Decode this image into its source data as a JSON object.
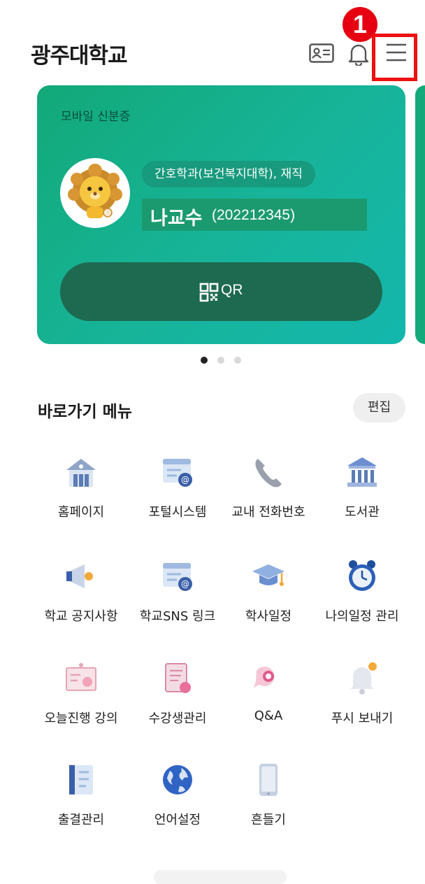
{
  "header": {
    "logo": "광주대학교",
    "badge": "1"
  },
  "card": {
    "title": "모바일 신분증",
    "department": "간호학과(보건복지대학), 재직",
    "name": "나교수",
    "number": "(202212345)",
    "qr_label": "QR",
    "accent": "#12a978"
  },
  "carousel": {
    "active_index": 0,
    "total": 3
  },
  "quick_menu": {
    "title": "바로가기 메뉴",
    "edit_label": "편집",
    "items": [
      {
        "label": "홈페이지",
        "icon": "school-building-icon"
      },
      {
        "label": "포털시스템",
        "icon": "portal-window-icon"
      },
      {
        "label": "교내 전화번호",
        "icon": "phone-icon"
      },
      {
        "label": "도서관",
        "icon": "library-icon"
      },
      {
        "label": "학교 공지사항",
        "icon": "megaphone-icon"
      },
      {
        "label": "학교SNS 링크",
        "icon": "sns-window-icon"
      },
      {
        "label": "학사일정",
        "icon": "graduation-cap-icon"
      },
      {
        "label": "나의일정 관리",
        "icon": "alarm-clock-icon"
      },
      {
        "label": "오늘진행 강의",
        "icon": "lecture-board-icon"
      },
      {
        "label": "수강생관리",
        "icon": "student-clipboard-icon"
      },
      {
        "label": "Q&A",
        "icon": "qna-bubble-icon"
      },
      {
        "label": "푸시 보내기",
        "icon": "push-bell-icon"
      },
      {
        "label": "출결관리",
        "icon": "attendance-notebook-icon"
      },
      {
        "label": "언어설정",
        "icon": "globe-icon"
      },
      {
        "label": "흔들기",
        "icon": "shake-phone-icon"
      }
    ]
  }
}
